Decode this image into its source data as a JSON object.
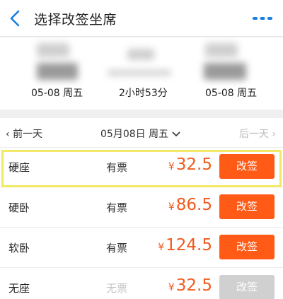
{
  "header": {
    "title": "选择改签坐席"
  },
  "trip": {
    "depart_date": "05-08 周五",
    "duration": "2小时53分",
    "arrive_date": "05-08 周五"
  },
  "date_bar": {
    "prev_label": "前一天",
    "current_label": "05月08日 周五",
    "next_label": "后一天"
  },
  "currency": "¥",
  "seats": [
    {
      "name": "硬座",
      "status": "有票",
      "price": "32.5",
      "action": "改签",
      "enabled": true,
      "highlighted": true
    },
    {
      "name": "硬卧",
      "status": "有票",
      "price": "86.5",
      "action": "改签",
      "enabled": true,
      "highlighted": false
    },
    {
      "name": "软卧",
      "status": "有票",
      "price": "124.5",
      "action": "改签",
      "enabled": true,
      "highlighted": false
    },
    {
      "name": "无座",
      "status": "无票",
      "price": "32.5",
      "action": "改签",
      "enabled": false,
      "highlighted": false
    }
  ],
  "colors": {
    "accent": "#ff5a16",
    "price": "#f25a1c",
    "nav_icon": "#1a7de2",
    "disabled": "#d0d0d0",
    "highlight_frame": "#f0e866"
  },
  "icons": {
    "back": "chevron-left-icon",
    "more": "more-dots-icon",
    "date_dropdown": "chevron-down-icon"
  }
}
